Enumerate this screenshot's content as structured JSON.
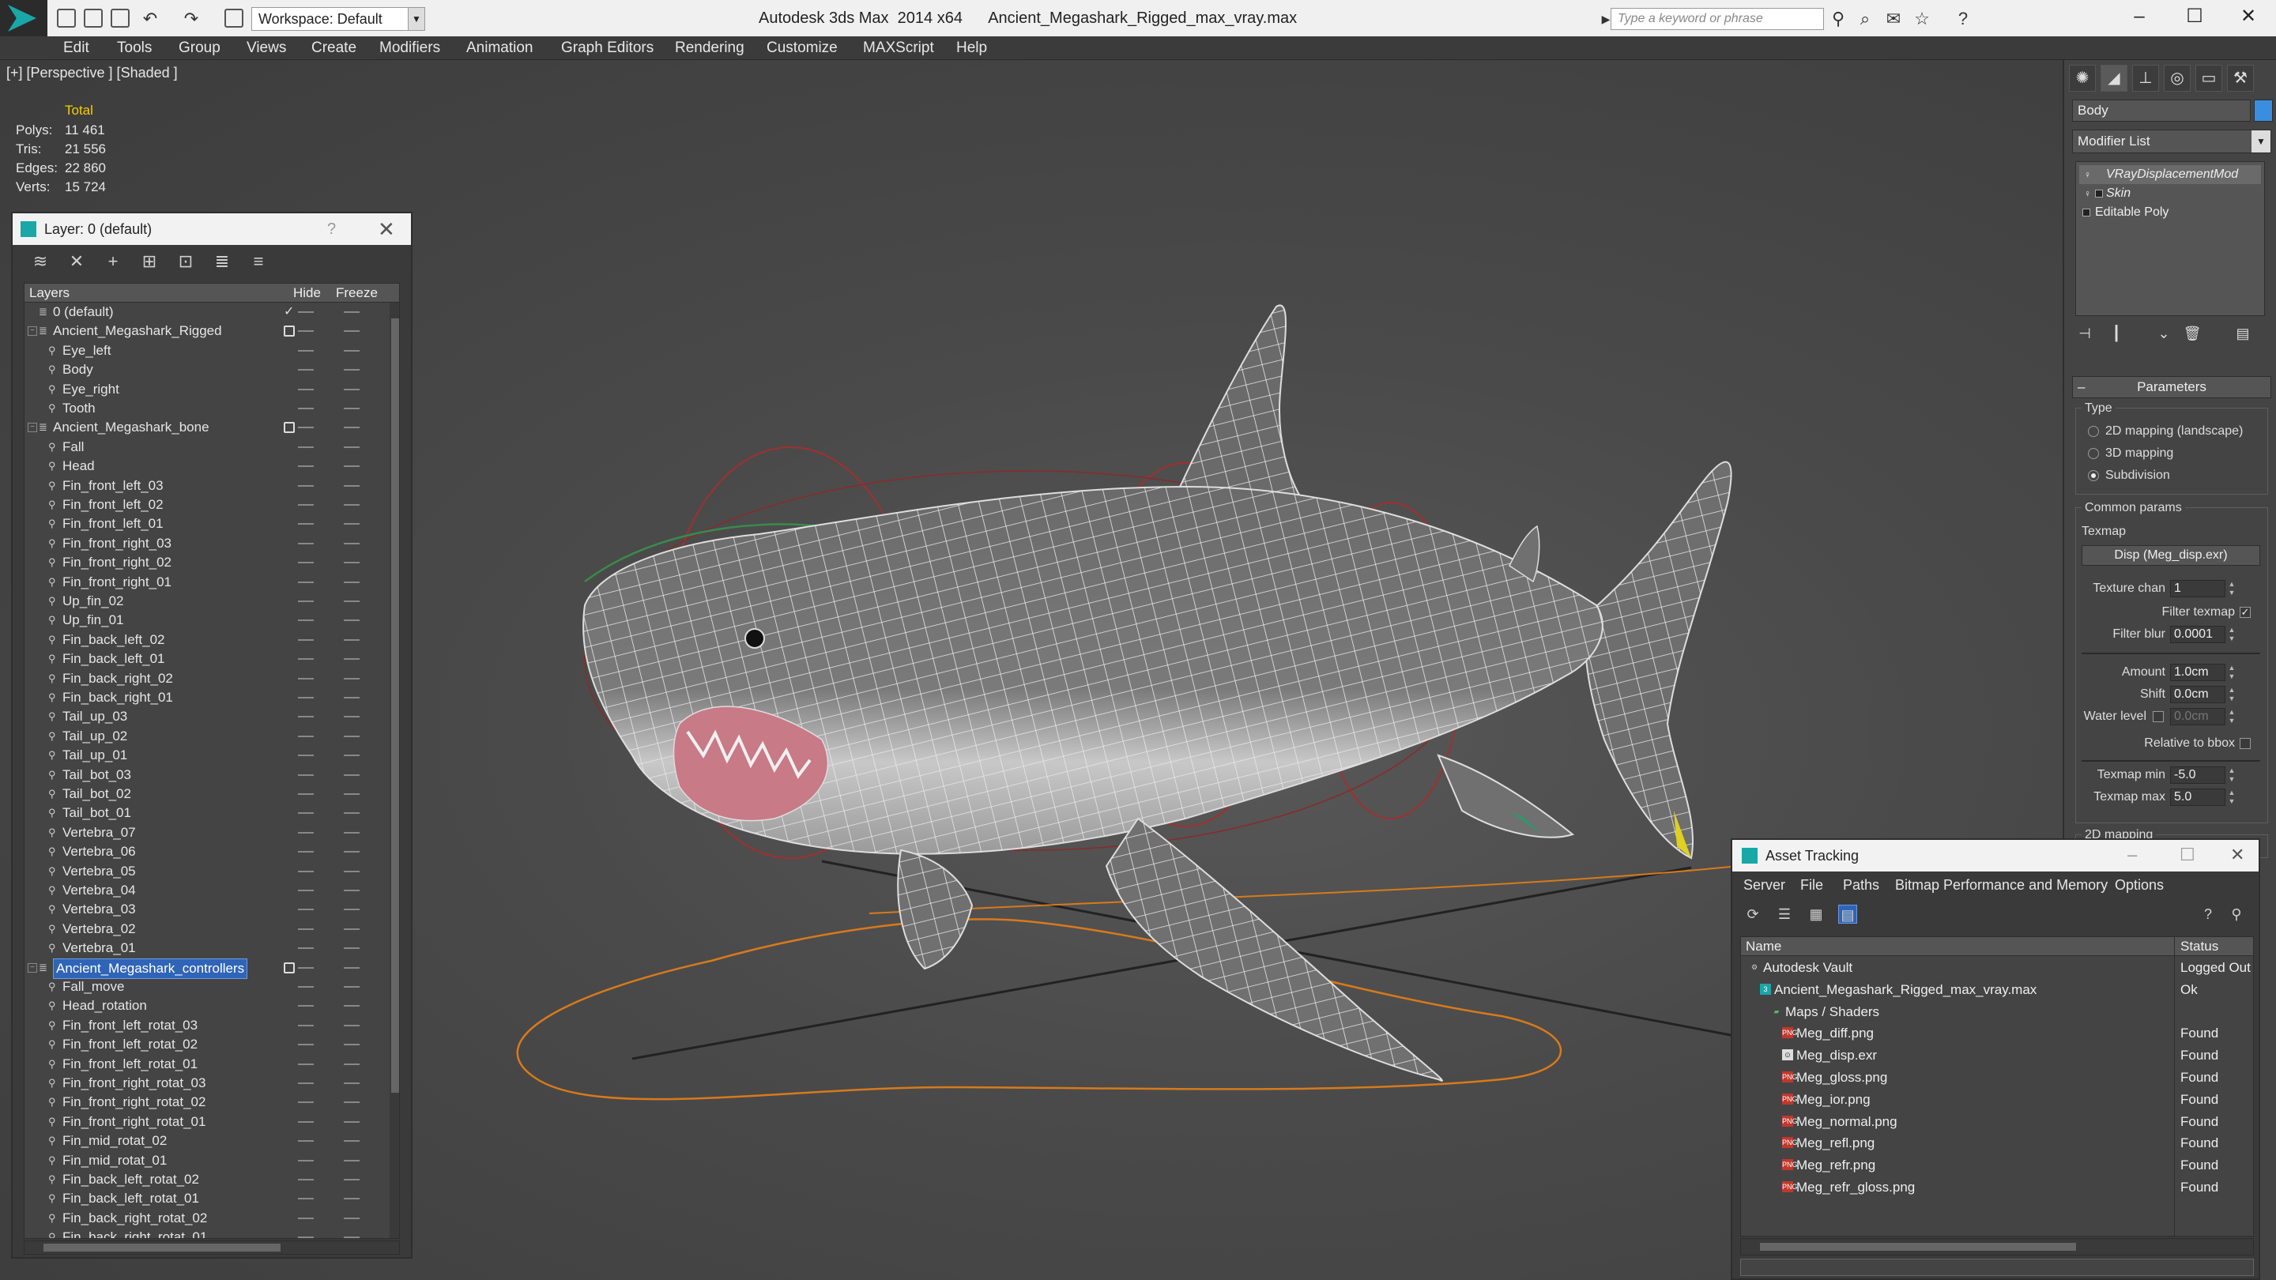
{
  "titlebar": {
    "app_title": "Autodesk 3ds Max  2014 x64",
    "file_name": "Ancient_Megashark_Rigged_max_vray.max",
    "workspace": "Workspace: Default",
    "search_placeholder": "Type a keyword or phrase"
  },
  "menu": [
    "Edit",
    "Tools",
    "Group",
    "Views",
    "Create",
    "Modifiers",
    "Animation",
    "Graph Editors",
    "Rendering",
    "Customize",
    "MAXScript",
    "Help"
  ],
  "viewport": {
    "label": "[+] [Perspective ] [Shaded ]",
    "stats": {
      "header": "Total",
      "rows": [
        {
          "k": "Polys:",
          "v": "11 461"
        },
        {
          "k": "Tris:",
          "v": "21 556"
        },
        {
          "k": "Edges:",
          "v": "22 860"
        },
        {
          "k": "Verts:",
          "v": "15 724"
        }
      ]
    }
  },
  "layer_panel": {
    "title": "Layer: 0 (default)",
    "help": "?",
    "col_layers": "Layers",
    "col_hide": "Hide",
    "col_freeze": "Freeze",
    "rows": [
      {
        "name": "0 (default)",
        "level": 0,
        "group": false,
        "current": true
      },
      {
        "name": "Ancient_Megashark_Rigged",
        "level": 0,
        "group": true
      },
      {
        "name": "Eye_left",
        "level": 1
      },
      {
        "name": "Body",
        "level": 1
      },
      {
        "name": "Eye_right",
        "level": 1
      },
      {
        "name": "Tooth",
        "level": 1
      },
      {
        "name": "Ancient_Megashark_bone",
        "level": 0,
        "group": true
      },
      {
        "name": "Fall",
        "level": 1
      },
      {
        "name": "Head",
        "level": 1
      },
      {
        "name": "Fin_front_left_03",
        "level": 1
      },
      {
        "name": "Fin_front_left_02",
        "level": 1
      },
      {
        "name": "Fin_front_left_01",
        "level": 1
      },
      {
        "name": "Fin_front_right_03",
        "level": 1
      },
      {
        "name": "Fin_front_right_02",
        "level": 1
      },
      {
        "name": "Fin_front_right_01",
        "level": 1
      },
      {
        "name": "Up_fin_02",
        "level": 1
      },
      {
        "name": "Up_fin_01",
        "level": 1
      },
      {
        "name": "Fin_back_left_02",
        "level": 1
      },
      {
        "name": "Fin_back_left_01",
        "level": 1
      },
      {
        "name": "Fin_back_right_02",
        "level": 1
      },
      {
        "name": "Fin_back_right_01",
        "level": 1
      },
      {
        "name": "Tail_up_03",
        "level": 1
      },
      {
        "name": "Tail_up_02",
        "level": 1
      },
      {
        "name": "Tail_up_01",
        "level": 1
      },
      {
        "name": "Tail_bot_03",
        "level": 1
      },
      {
        "name": "Tail_bot_02",
        "level": 1
      },
      {
        "name": "Tail_bot_01",
        "level": 1
      },
      {
        "name": "Vertebra_07",
        "level": 1
      },
      {
        "name": "Vertebra_06",
        "level": 1
      },
      {
        "name": "Vertebra_05",
        "level": 1
      },
      {
        "name": "Vertebra_04",
        "level": 1
      },
      {
        "name": "Vertebra_03",
        "level": 1
      },
      {
        "name": "Vertebra_02",
        "level": 1
      },
      {
        "name": "Vertebra_01",
        "level": 1
      },
      {
        "name": "Ancient_Megashark_controllers",
        "level": 0,
        "group": true,
        "selected": true
      },
      {
        "name": "Fall_move",
        "level": 1
      },
      {
        "name": "Head_rotation",
        "level": 1
      },
      {
        "name": "Fin_front_left_rotat_03",
        "level": 1
      },
      {
        "name": "Fin_front_left_rotat_02",
        "level": 1
      },
      {
        "name": "Fin_front_left_rotat_01",
        "level": 1
      },
      {
        "name": "Fin_front_right_rotat_03",
        "level": 1
      },
      {
        "name": "Fin_front_right_rotat_02",
        "level": 1
      },
      {
        "name": "Fin_front_right_rotat_01",
        "level": 1
      },
      {
        "name": "Fin_mid_rotat_02",
        "level": 1
      },
      {
        "name": "Fin_mid_rotat_01",
        "level": 1
      },
      {
        "name": "Fin_back_left_rotat_02",
        "level": 1
      },
      {
        "name": "Fin_back_left_rotat_01",
        "level": 1
      },
      {
        "name": "Fin_back_right_rotat_02",
        "level": 1
      },
      {
        "name": "Fin_back_right_rotat_01",
        "level": 1
      }
    ]
  },
  "command_panel": {
    "object_name": "Body",
    "object_color": "#3a8ee0",
    "modifier_list": "Modifier List",
    "stack": [
      {
        "label": "VRayDisplacementMod",
        "italic": true,
        "highlight": true
      },
      {
        "label": "Skin",
        "italic": true,
        "highlight": false
      },
      {
        "label": "Editable Poly",
        "italic": false,
        "highlight": false
      }
    ],
    "params": {
      "rollout": "Parameters",
      "type_label": "Type",
      "type_options": [
        {
          "label": "2D mapping (landscape)",
          "on": false
        },
        {
          "label": "3D mapping",
          "on": false
        },
        {
          "label": "Subdivision",
          "on": true
        }
      ],
      "common_params": "Common params",
      "texmap": "Texmap",
      "texmap_button": "Disp (Meg_disp.exr)",
      "texture_chan_label": "Texture chan",
      "texture_chan": "1",
      "filter_texmap": "Filter texmap",
      "filter_blur_label": "Filter blur",
      "filter_blur": "0.0001",
      "amount_label": "Amount",
      "amount": "1.0cm",
      "shift_label": "Shift",
      "shift": "0.0cm",
      "water_level_label": "Water level",
      "water_level": "0.0cm",
      "relative_bbox": "Relative to bbox",
      "texmap_min_label": "Texmap min",
      "texmap_min": "-5.0",
      "texmap_max_label": "Texmap max",
      "texmap_max": "5.0",
      "next_rollout": "2D mapping"
    }
  },
  "asset_panel": {
    "title": "Asset Tracking",
    "menu": [
      "Server",
      "File",
      "Paths",
      "Bitmap Performance and Memory",
      "Options"
    ],
    "col_name": "Name",
    "col_status": "Status",
    "rows": [
      {
        "name": "Autodesk Vault",
        "status": "Logged Out",
        "level": 0,
        "icon": "vault"
      },
      {
        "name": "Ancient_Megashark_Rigged_max_vray.max",
        "status": "Ok",
        "level": 1,
        "icon": "max"
      },
      {
        "name": "Maps / Shaders",
        "status": "",
        "level": 2,
        "icon": "folder"
      },
      {
        "name": "Meg_diff.png",
        "status": "Found",
        "level": 3,
        "icon": "png"
      },
      {
        "name": "Meg_disp.exr",
        "status": "Found",
        "level": 3,
        "icon": "exr"
      },
      {
        "name": "Meg_gloss.png",
        "status": "Found",
        "level": 3,
        "icon": "png"
      },
      {
        "name": "Meg_ior.png",
        "status": "Found",
        "level": 3,
        "icon": "png"
      },
      {
        "name": "Meg_normal.png",
        "status": "Found",
        "level": 3,
        "icon": "png"
      },
      {
        "name": "Meg_refl.png",
        "status": "Found",
        "level": 3,
        "icon": "png"
      },
      {
        "name": "Meg_refr.png",
        "status": "Found",
        "level": 3,
        "icon": "png"
      },
      {
        "name": "Meg_refr_gloss.png",
        "status": "Found",
        "level": 3,
        "icon": "png"
      }
    ]
  }
}
